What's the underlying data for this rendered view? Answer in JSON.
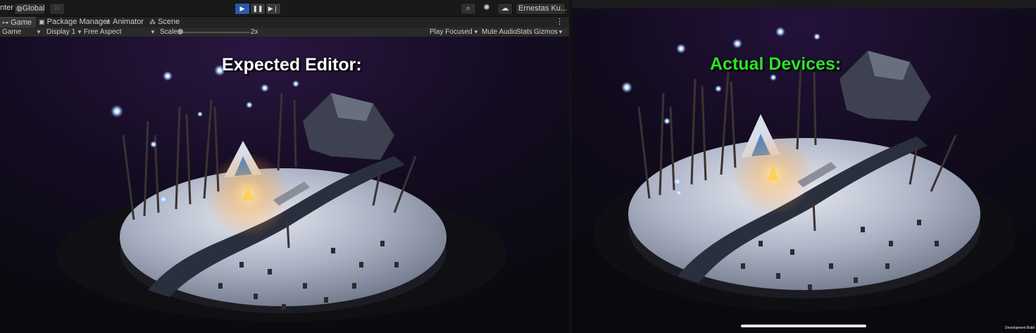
{
  "editor": {
    "toolbar": {
      "center_label": "nter",
      "global_label": "Global",
      "account_label": "Ernestas Ku...",
      "icons": [
        "grid-snap-icon",
        "play-icon",
        "pause-icon",
        "step-icon",
        "search-icon",
        "settings-icon",
        "cloud-icon"
      ]
    },
    "tabs": [
      {
        "label": "Game",
        "icon": "gamepad-icon",
        "active": true
      },
      {
        "label": "Package Manager",
        "icon": "package-icon",
        "active": false
      },
      {
        "label": "Animator",
        "icon": "animator-icon",
        "active": false
      },
      {
        "label": "Scene",
        "icon": "scene-icon",
        "active": false
      }
    ],
    "game_bar": {
      "view_select": "Game",
      "display_select": "Display 1",
      "aspect_select": "Free Aspect",
      "scale_label": "Scale",
      "scale_value": "2x",
      "scale_fraction": 0.0,
      "play_mode_select": "Play Focused",
      "mute_label": "Mute Audio",
      "stats_label": "Stats",
      "gizmos_label": "Gizmos"
    },
    "overlay_text": "Expected Editor:",
    "overlay_color": "#ffffff"
  },
  "device": {
    "overlay_text": "Actual Devices:",
    "overlay_color": "#2fe02a",
    "dev_build_label": "Development Build"
  },
  "colors": {
    "play_active": "#2b5aa8",
    "editor_bg": "#1e1e1e"
  }
}
